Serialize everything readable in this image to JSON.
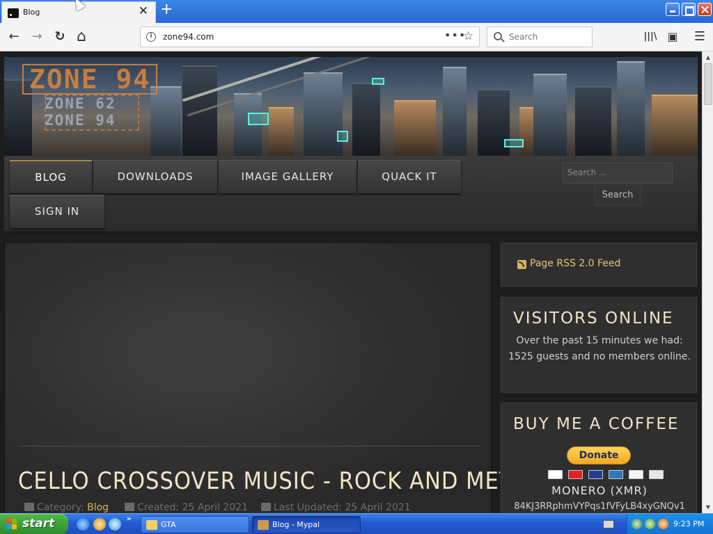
{
  "browser": {
    "tab_title": "Blog",
    "new_tab_symbol": "+",
    "close_symbol": "✕",
    "url": "zone94.com",
    "page_actions": "•••",
    "bookmark_symbol": "☆",
    "search_placeholder": "Search",
    "nav": {
      "back": "←",
      "forward": "→",
      "reload": "↻",
      "home": "⌂",
      "library": "|||\\",
      "sidebar": "▣",
      "menu": "☰"
    }
  },
  "site": {
    "logo_main": "ZONE 94",
    "logo_sub_1": "ZONE 62",
    "logo_sub_2": "ZONE 94",
    "menu": [
      {
        "label": "BLOG"
      },
      {
        "label": "DOWNLOADS"
      },
      {
        "label": "IMAGE GALLERY"
      },
      {
        "label": "QUACK IT"
      },
      {
        "label": "SIGN IN"
      }
    ],
    "search_placeholder": "Search ...",
    "search_button": "Search"
  },
  "article": {
    "title": "CELLO CROSSOVER MUSIC - ROCK AND METAL",
    "category_label": "Category:",
    "category": "Blog",
    "created": "Created: 25 April 2021",
    "updated": "Last Updated: 25 April 2021"
  },
  "sidebar": {
    "rss": "Page RSS 2.0 Feed",
    "visitors_title": "VISITORS ONLINE",
    "visitors_text": "Over the past 15 minutes we had: 1525 guests and no members online.",
    "coffee_title": "BUY ME A COFFEE",
    "donate_label": "Donate",
    "monero": "MONERO (XMR)",
    "address": "84KJ3RRphmVYPqs1fVFyLB4xyGNQv1"
  },
  "taskbar": {
    "start": "start",
    "more": "»",
    "tasks": [
      {
        "label": "GTA"
      },
      {
        "label": "Blog - Mypal"
      }
    ],
    "clock": "9:23 PM"
  },
  "colors": {
    "accent_gold": "#d6b35d",
    "title_cream": "#f1e6c8",
    "xp_blue": "#235bd0",
    "start_green": "#2d8a2c"
  }
}
